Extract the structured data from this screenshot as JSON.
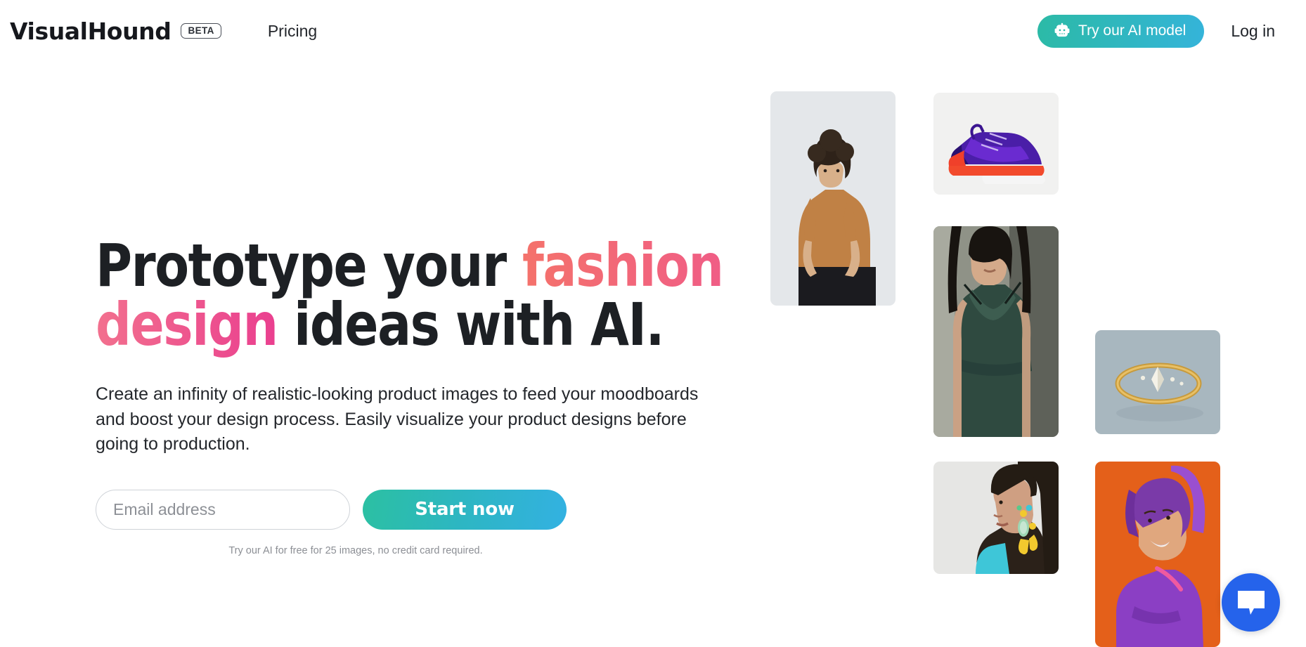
{
  "nav": {
    "brand": "VisualHound",
    "beta_badge": "BETA",
    "pricing_label": "Pricing",
    "ai_model_button": "Try our AI model",
    "ai_model_icon": "robot-icon",
    "login_label": "Log in"
  },
  "hero": {
    "headline_line1_part1": "Prototype your ",
    "headline_line1_accent": "fashion",
    "headline_line2_accent": "design",
    "headline_line2_part2": " ideas with AI.",
    "subcopy": "Create an infinity of realistic-looking product images to feed your moodboards and boost your design process. Easily visualize your product designs before going to production.",
    "email_placeholder": "Email address",
    "email_value": "",
    "cta_label": "Start now",
    "fineprint": "Try our AI for free for 25 images, no credit card required."
  },
  "colors": {
    "accent_teal": "#2cbaa6",
    "accent_blue": "#35b4da",
    "accent_coral": "#f4726b",
    "accent_pink": "#ea3f8f",
    "headline_dark": "#1d2024",
    "chat_blue": "#2563eb"
  },
  "collage": {
    "items": [
      {
        "name": "man-in-tan-tshirt",
        "alt": "Man with curly hair wearing a tan t-shirt"
      },
      {
        "name": "purple-red-sneaker",
        "alt": "Purple and red running sneaker"
      },
      {
        "name": "woman-green-slip-dress",
        "alt": "Woman wearing a green satin slip dress"
      },
      {
        "name": "gold-diamond-ring",
        "alt": "Gold ring with marquise diamond on blue-grey background"
      },
      {
        "name": "woman-with-statement-earrings",
        "alt": "Woman in turquoise top with yellow statement earrings"
      },
      {
        "name": "woman-purple-hair-orange-bg",
        "alt": "Smiling woman with purple bob hair on orange background"
      }
    ]
  },
  "chat": {
    "widget_icon": "chat-bubble-icon",
    "widget_label": "Open chat"
  }
}
